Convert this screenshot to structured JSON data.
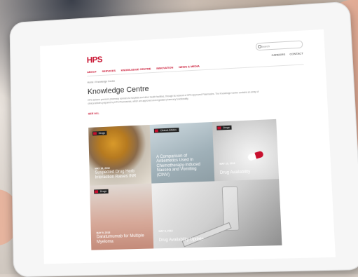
{
  "site": {
    "logo": "HPS",
    "search_placeholder": "Search",
    "util_nav": [
      "CAREERS",
      "CONTACT"
    ],
    "nav": [
      "ABOUT",
      "SERVICES",
      "KNOWLEDGE CENTRE",
      "INNOVATION",
      "NEWS & MEDIA"
    ],
    "breadcrumb": "Home / Knowledge Centre",
    "page_title": "Knowledge Centre",
    "intro": "HPS delivers premium pharmacy services to hospitals and other health facilities, through its network of HPS Approved Pharmacies. The Knowledge Centre contains an array of clinical articles prepared by HPS Pharmacists, which are approved and regulated pharmacy functionality.",
    "see_all": "SEE ALL"
  },
  "cards": [
    {
      "tag": "Drugs",
      "date": "MAY 18, 2018",
      "title": "Suspected Drug Herb Interaction Raises INR"
    },
    {
      "tag": "Clinical Articles",
      "date": "",
      "title": "A Comparison of Antiemetics Used in Chemotherapy-Induced Nausea and Vomiting (CINV)"
    },
    {
      "tag": "Drugs",
      "date": "MAY 10, 2018",
      "title": "Drug Availability"
    },
    {
      "tag": "Drugs",
      "date": "MAY 9, 2018",
      "title": "Daratumumab for Multiple Myeloma"
    },
    {
      "tag": "Drugs",
      "date": "MAY 8, 2018",
      "title": "Drug Availability Update"
    }
  ],
  "colors": {
    "brand": "#c8102e"
  }
}
